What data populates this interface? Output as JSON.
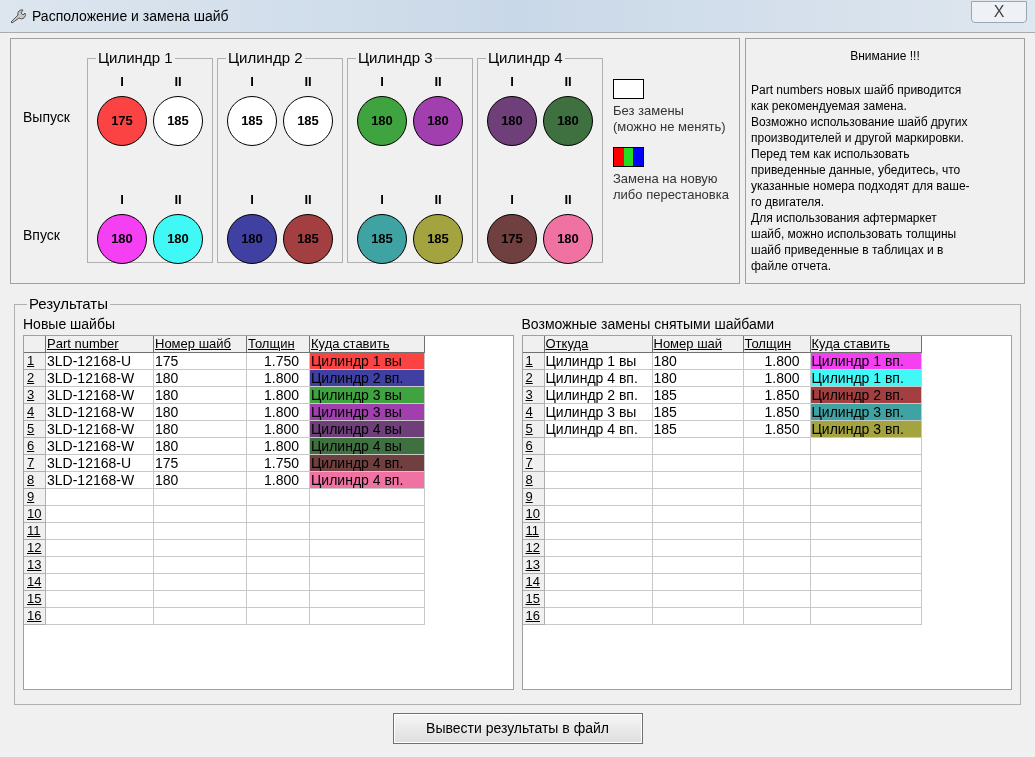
{
  "window": {
    "title": "Расположение и замена шайб",
    "close": "X"
  },
  "layout": {
    "row_labels": [
      "Выпуск",
      "Впуск"
    ],
    "cylinders": [
      {
        "title": "Цилиндр 1",
        "rows": [
          [
            {
              "label": "I",
              "value": "175",
              "color": "#fc4343"
            },
            {
              "label": "II",
              "value": "185",
              "color": "#ffffff"
            }
          ],
          [
            {
              "label": "I",
              "value": "180",
              "color": "#f43ff2"
            },
            {
              "label": "II",
              "value": "180",
              "color": "#40f8f5"
            }
          ]
        ]
      },
      {
        "title": "Цилиндр 2",
        "rows": [
          [
            {
              "label": "I",
              "value": "185",
              "color": "#ffffff"
            },
            {
              "label": "II",
              "value": "185",
              "color": "#ffffff"
            }
          ],
          [
            {
              "label": "I",
              "value": "180",
              "color": "#3f40a2"
            },
            {
              "label": "II",
              "value": "185",
              "color": "#a33f40"
            }
          ]
        ]
      },
      {
        "title": "Цилиндр 3",
        "rows": [
          [
            {
              "label": "I",
              "value": "180",
              "color": "#3fa43f"
            },
            {
              "label": "II",
              "value": "180",
              "color": "#a23fae"
            }
          ],
          [
            {
              "label": "I",
              "value": "185",
              "color": "#3fa3a3"
            },
            {
              "label": "II",
              "value": "185",
              "color": "#a3a33f"
            }
          ]
        ]
      },
      {
        "title": "Цилиндр 4",
        "rows": [
          [
            {
              "label": "I",
              "value": "180",
              "color": "#6f3f7a"
            },
            {
              "label": "II",
              "value": "180",
              "color": "#3f7040"
            }
          ],
          [
            {
              "label": "I",
              "value": "175",
              "color": "#703f3f"
            },
            {
              "label": "II",
              "value": "180",
              "color": "#ef72a3"
            }
          ]
        ]
      }
    ],
    "legend": [
      {
        "kind": "blank",
        "text": [
          "Без замены",
          "(можно не менять)"
        ]
      },
      {
        "kind": "rgb",
        "text": [
          "Замена на новую",
          "либо перестановка"
        ]
      }
    ]
  },
  "notice": {
    "title": "Внимание !!!",
    "lines": [
      "Part numbers новых шайб приводится",
      "как рекомендуемая замена.",
      "Возможно использование шайб других",
      "производителей и другой маркировки.",
      "Перед тем как использовать",
      "приведенные данные, убедитесь, что",
      "указанные номера подходят для ваше-",
      "го двигателя.",
      "Для использования афтермаркет",
      "шайб, можно использовать толщины",
      "шайб приведенные в таблицах и в",
      "файле отчета."
    ]
  },
  "results": {
    "title": "Результаты",
    "tables": [
      {
        "title": "Новые шайбы",
        "columns": [
          "Part number",
          "Номер шайб",
          "Толщин",
          "Куда ставить"
        ],
        "rows": [
          {
            "num": "1",
            "cells": [
              "3LD-12168-U",
              "175",
              "1.750",
              "Цилиндр 1 вы"
            ],
            "color": "#fc4343"
          },
          {
            "num": "2",
            "cells": [
              "3LD-12168-W",
              "180",
              "1.800",
              "Цилиндр 2 вп."
            ],
            "color": "#3f40a2"
          },
          {
            "num": "3",
            "cells": [
              "3LD-12168-W",
              "180",
              "1.800",
              "Цилиндр 3 вы"
            ],
            "color": "#3fa43f"
          },
          {
            "num": "4",
            "cells": [
              "3LD-12168-W",
              "180",
              "1.800",
              "Цилиндр 3 вы"
            ],
            "color": "#a23fae"
          },
          {
            "num": "5",
            "cells": [
              "3LD-12168-W",
              "180",
              "1.800",
              "Цилиндр 4 вы"
            ],
            "color": "#6f3f7a"
          },
          {
            "num": "6",
            "cells": [
              "3LD-12168-W",
              "180",
              "1.800",
              "Цилиндр 4 вы"
            ],
            "color": "#3f7040"
          },
          {
            "num": "7",
            "cells": [
              "3LD-12168-U",
              "175",
              "1.750",
              "Цилиндр 4 вп."
            ],
            "color": "#703f3f"
          },
          {
            "num": "8",
            "cells": [
              "3LD-12168-W",
              "180",
              "1.800",
              "Цилиндр 4 вп."
            ],
            "color": "#ef72a3"
          },
          {
            "num": "9"
          },
          {
            "num": "10"
          },
          {
            "num": "11"
          },
          {
            "num": "12"
          },
          {
            "num": "13"
          },
          {
            "num": "14"
          },
          {
            "num": "15"
          },
          {
            "num": "16"
          }
        ]
      },
      {
        "title": "Возможные замены снятыми шайбами",
        "columns": [
          "Откуда",
          "Номер шай",
          "Толщин",
          "Куда ставить"
        ],
        "rows": [
          {
            "num": "1",
            "cells": [
              "Цилиндр 1 вы",
              "180",
              "1.800",
              "Цилиндр 1 вп."
            ],
            "color": "#f43ff2"
          },
          {
            "num": "2",
            "cells": [
              "Цилиндр 4 вп.",
              "180",
              "1.800",
              "Цилиндр 1 вп."
            ],
            "color": "#40f8f5"
          },
          {
            "num": "3",
            "cells": [
              "Цилиндр 2 вп.",
              "185",
              "1.850",
              "Цилиндр 2 вп."
            ],
            "color": "#a33f40"
          },
          {
            "num": "4",
            "cells": [
              "Цилиндр 3 вы",
              "185",
              "1.850",
              "Цилиндр 3 вп."
            ],
            "color": "#3fa3a3"
          },
          {
            "num": "5",
            "cells": [
              "Цилиндр 4 вп.",
              "185",
              "1.850",
              "Цилиндр 3 вп."
            ],
            "color": "#a3a33f"
          },
          {
            "num": "6"
          },
          {
            "num": "7"
          },
          {
            "num": "8"
          },
          {
            "num": "9"
          },
          {
            "num": "10"
          },
          {
            "num": "11"
          },
          {
            "num": "12"
          },
          {
            "num": "13"
          },
          {
            "num": "14"
          },
          {
            "num": "15"
          },
          {
            "num": "16"
          }
        ]
      }
    ]
  },
  "export_button": "Вывести результаты в файл"
}
